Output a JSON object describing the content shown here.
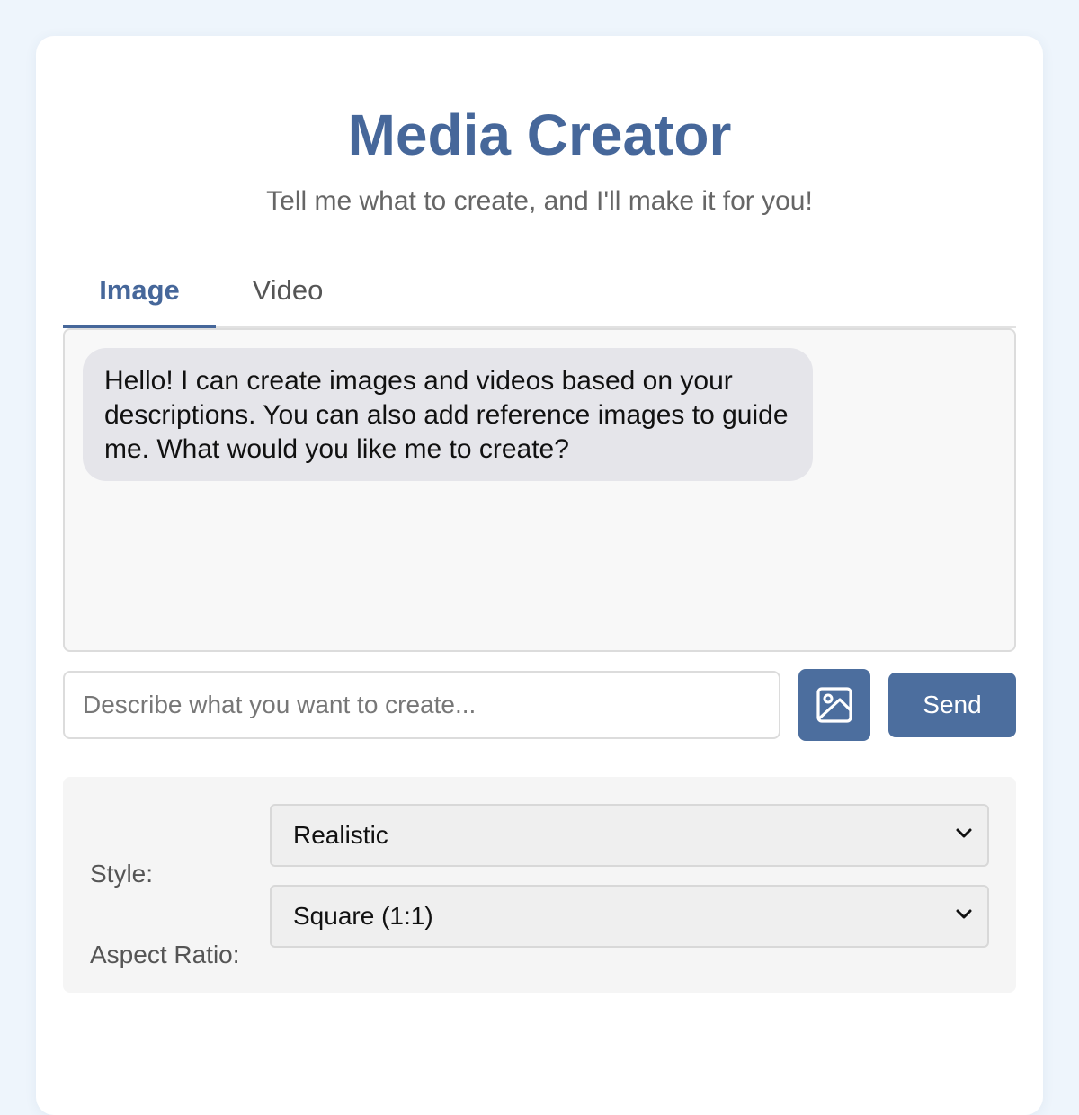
{
  "header": {
    "title": "Media Creator",
    "subtitle": "Tell me what to create, and I'll make it for you!"
  },
  "tabs": [
    {
      "label": "Image",
      "active": true
    },
    {
      "label": "Video",
      "active": false
    }
  ],
  "chat": {
    "messages": [
      {
        "sender": "assistant",
        "text": "Hello! I can create images and videos based on your descriptions. You can also add reference images to guide me. What would you like me to create?"
      }
    ]
  },
  "composer": {
    "placeholder": "Describe what you want to create...",
    "value": "",
    "upload_icon": "image-upload-icon",
    "send_label": "Send"
  },
  "options": {
    "style": {
      "label": "Style:",
      "selected": "Realistic",
      "icon": "chevron-down-icon"
    },
    "aspect_ratio": {
      "label": "Aspect Ratio:",
      "selected": "Square (1:1)",
      "icon": "chevron-down-icon"
    }
  },
  "colors": {
    "background": "#eef5fc",
    "accent": "#46679a",
    "button": "#4c6e9e",
    "bubble": "#e5e5ea"
  }
}
